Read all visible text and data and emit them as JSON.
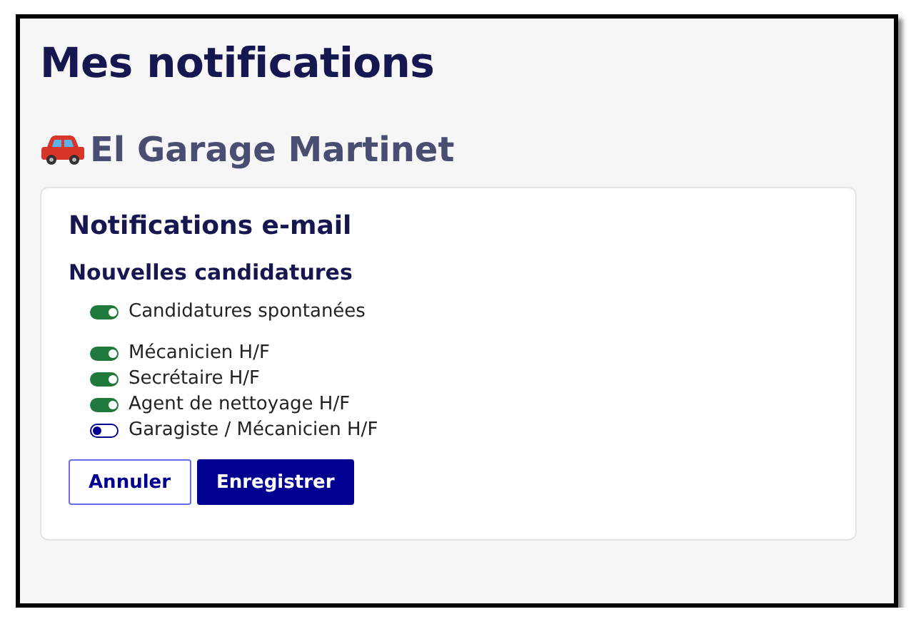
{
  "page_title": "Mes notifications",
  "company": {
    "name": "El Garage Martinet"
  },
  "card": {
    "title": "Notifications e-mail",
    "section": "Nouvelles candidatures",
    "groups": [
      [
        {
          "label": "Candidatures spontanées",
          "on": true
        }
      ],
      [
        {
          "label": "Mécanicien H/F",
          "on": true
        },
        {
          "label": "Secrétaire H/F",
          "on": true
        },
        {
          "label": "Agent de nettoyage H/F",
          "on": true
        },
        {
          "label": "Garagiste / Mécanicien H/F",
          "on": false
        }
      ]
    ]
  },
  "buttons": [
    {
      "label": "Annuler",
      "kind": "secondary"
    },
    {
      "label": "Enregistrer",
      "kind": "primary"
    }
  ]
}
